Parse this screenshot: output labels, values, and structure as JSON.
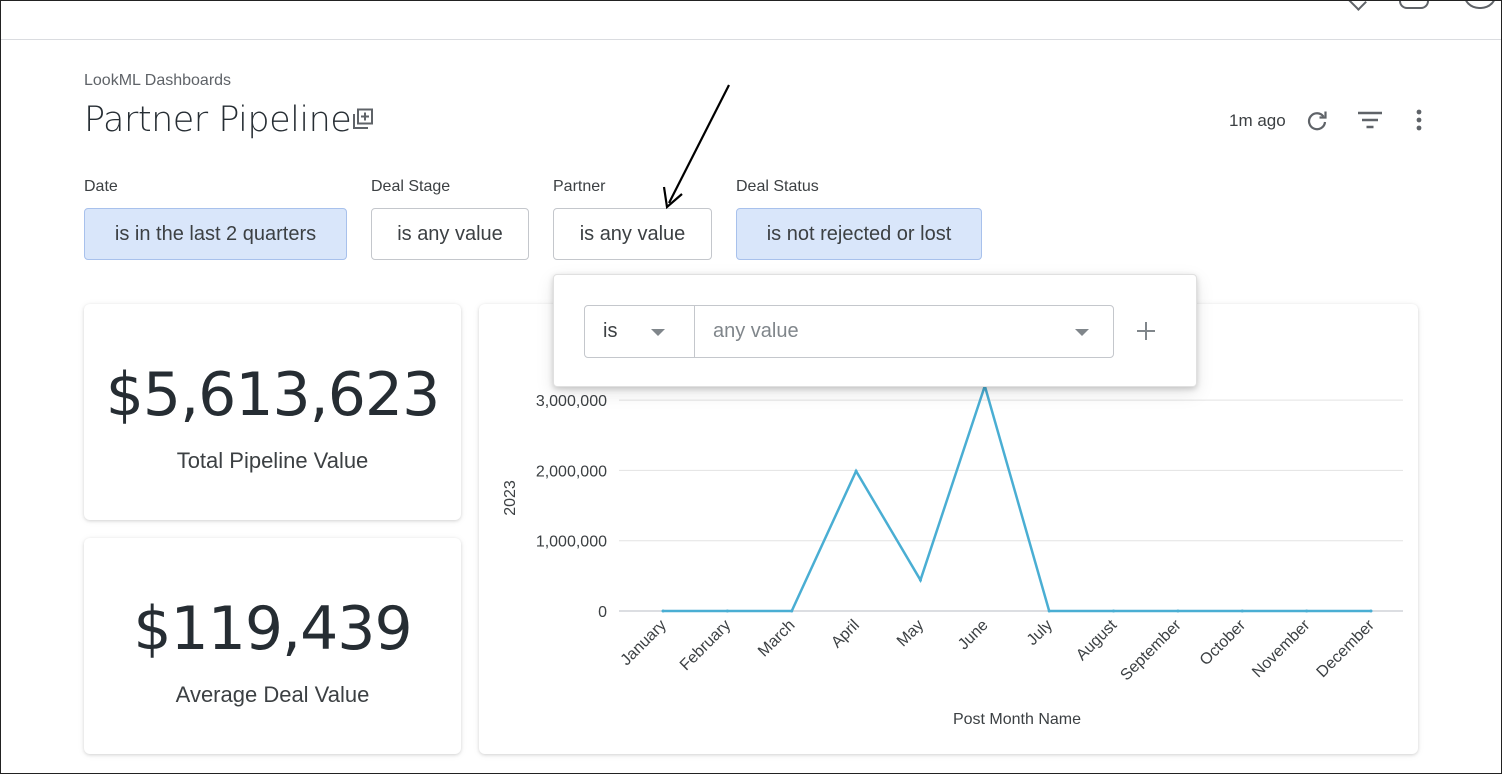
{
  "header": {
    "breadcrumb": "LookML Dashboards",
    "title": "Partner Pipeline",
    "updated": "1m ago"
  },
  "filters": [
    {
      "label": "Date",
      "value": "is in the last 2 quarters",
      "active": true
    },
    {
      "label": "Deal Stage",
      "value": "is any value",
      "active": false
    },
    {
      "label": "Partner",
      "value": "is any value",
      "active": false
    },
    {
      "label": "Deal Status",
      "value": "is not rejected or lost",
      "active": true
    }
  ],
  "popover": {
    "operator": "is",
    "value_placeholder": "any value"
  },
  "kpis": [
    {
      "value": "$5,613,623",
      "label": "Total Pipeline Value"
    },
    {
      "value": "$119,439",
      "label": "Average Deal Value"
    }
  ],
  "icons": {
    "duplicate": "add-to-board-icon",
    "refresh": "refresh-icon",
    "filter": "filter-list-icon",
    "more": "more-vert-icon",
    "add": "plus-icon"
  },
  "colors": {
    "accent_chip": "#d9e6fa",
    "series": "#4aaed3",
    "grid": "#e3e3e3"
  },
  "chart_data": {
    "type": "line",
    "x": [
      "January",
      "February",
      "March",
      "April",
      "May",
      "June",
      "July",
      "August",
      "September",
      "October",
      "November",
      "December"
    ],
    "series": [
      {
        "name": "2023",
        "values": [
          0,
          0,
          0,
          1990000,
          440000,
          3200000,
          0,
          0,
          0,
          0,
          0,
          0
        ]
      }
    ],
    "xlabel": "Post Month Name",
    "ylabel": "2023",
    "yticks": [
      0,
      1000000,
      2000000,
      3000000
    ],
    "ytick_labels": [
      "0",
      "1,000,000",
      "2,000,000",
      "3,000,000"
    ],
    "grid": true
  }
}
